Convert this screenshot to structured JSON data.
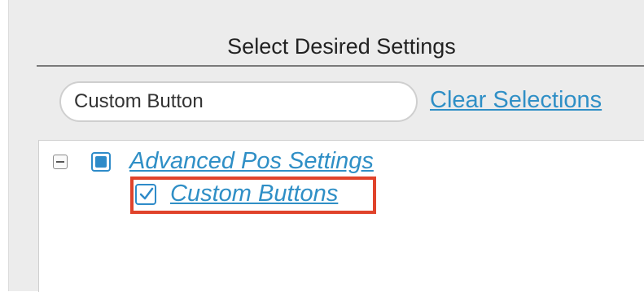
{
  "header": {
    "title": "Select Desired Settings"
  },
  "search": {
    "value": "Custom Button"
  },
  "actions": {
    "clear_label": "Clear Selections"
  },
  "tree": {
    "parent": {
      "label": "Advanced Pos Settings",
      "state": "partial",
      "expanded": true
    },
    "children": [
      {
        "label": "Custom Buttons",
        "checked": true,
        "highlighted": true
      }
    ]
  },
  "colors": {
    "accent": "#2f8fc6",
    "highlight_border": "#e0432b",
    "panel_bg": "#ececec"
  }
}
